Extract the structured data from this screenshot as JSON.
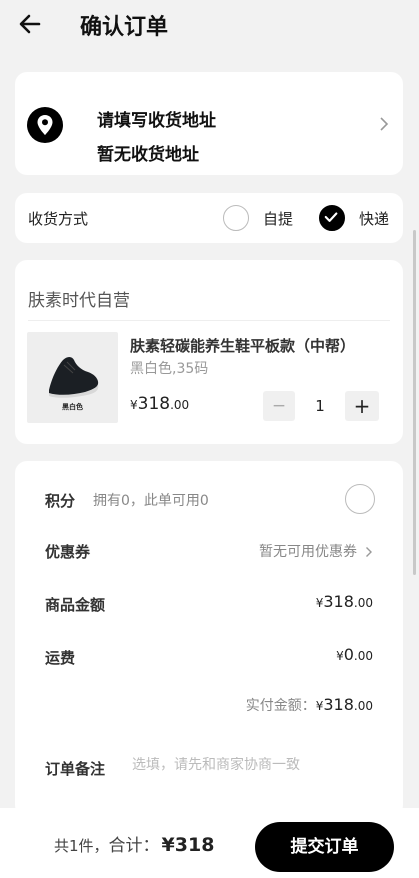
{
  "header": {
    "title": "确认订单"
  },
  "address": {
    "line1": "请填写收货地址",
    "line2": "暂无收货地址"
  },
  "delivery": {
    "label": "收货方式",
    "options": [
      {
        "label": "自提",
        "selected": false
      },
      {
        "label": "快递",
        "selected": true
      }
    ]
  },
  "product": {
    "store": "肤素时代自营",
    "thumb_tag": "黑白色",
    "name": "肤素轻碳能养生鞋平板款（中帮）",
    "spec": "黑白色,35码",
    "price_symbol": "¥",
    "price_int": "318",
    "price_dec": ".00",
    "qty_minus": "−",
    "qty": "1",
    "qty_plus": "+"
  },
  "summary": {
    "points_label": "积分",
    "points_note": "拥有0，此单可用0",
    "coupon_label": "优惠券",
    "coupon_value": "暂无可用优惠券",
    "goods_label": "商品金额",
    "goods_symbol": "¥",
    "goods_int": "318",
    "goods_dec": ".00",
    "shipping_label": "运费",
    "shipping_symbol": "¥",
    "shipping_int": "0",
    "shipping_dec": ".00",
    "actual_label": "实付金额：",
    "actual_symbol": "¥",
    "actual_int": "318",
    "actual_dec": ".00",
    "remark_label": "订单备注",
    "remark_placeholder": "选填，请先和商家协商一致"
  },
  "footer": {
    "count_text": "共1件，",
    "total_label": "合计：",
    "total_amount": "¥318",
    "submit_label": "提交订单"
  },
  "colors": {
    "accent": "#000000",
    "background": "#f2f2f2",
    "card": "#ffffff",
    "muted": "#888888"
  }
}
